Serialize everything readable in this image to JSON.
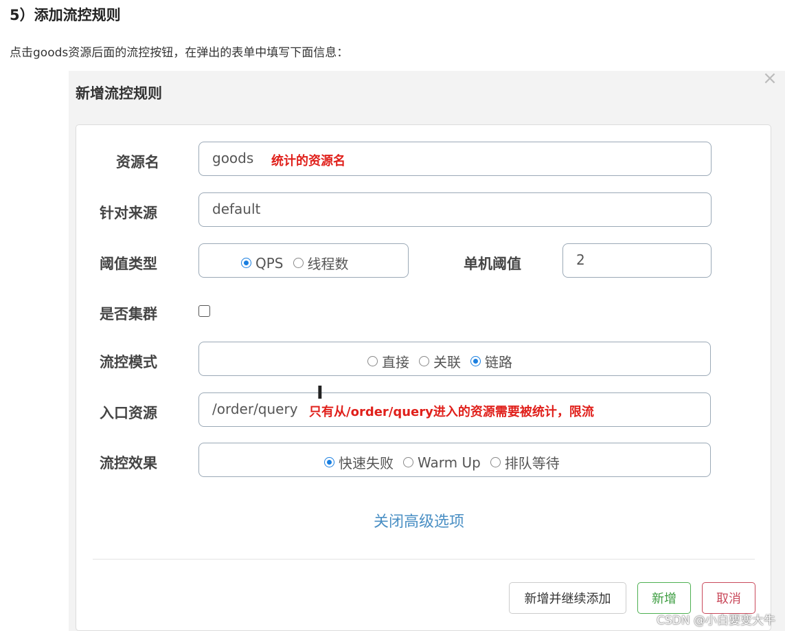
{
  "article": {
    "heading": "5）添加流控规则",
    "intro": "点击goods资源后面的流控按钮，在弹出的表单中填写下面信息："
  },
  "dialog": {
    "title": "新增流控规则",
    "close_icon": "close-icon",
    "fields": {
      "resource_label": "资源名",
      "resource_value": "goods",
      "resource_note": "统计的资源名",
      "origin_label": "针对来源",
      "origin_value": "default",
      "threshold_type_label": "阈值类型",
      "threshold_type_options": [
        "QPS",
        "线程数"
      ],
      "threshold_type_selected": "QPS",
      "single_threshold_label": "单机阈值",
      "single_threshold_value": "2",
      "cluster_label": "是否集群",
      "cluster_checked": false,
      "mode_label": "流控模式",
      "mode_options": [
        "直接",
        "关联",
        "链路"
      ],
      "mode_selected": "链路",
      "entry_label": "入口资源",
      "entry_value": "/order/query",
      "entry_note": "只有从/order/query进入的资源需要被统计，限流",
      "effect_label": "流控效果",
      "effect_options": [
        "快速失败",
        "Warm Up",
        "排队等待"
      ],
      "effect_selected": "快速失败"
    },
    "advanced_link": "关闭高级选项",
    "buttons": {
      "add_continue": "新增并继续添加",
      "add": "新增",
      "cancel": "取消"
    },
    "colors": {
      "accent": "#1a7fe0",
      "note": "#e0201b",
      "link": "#4a8fc4",
      "add_button": "#3b9c3f",
      "cancel_button": "#c9485a"
    }
  },
  "cursor_icon": "text-cursor-icon",
  "watermark": "CSDN @小白要变大牛"
}
